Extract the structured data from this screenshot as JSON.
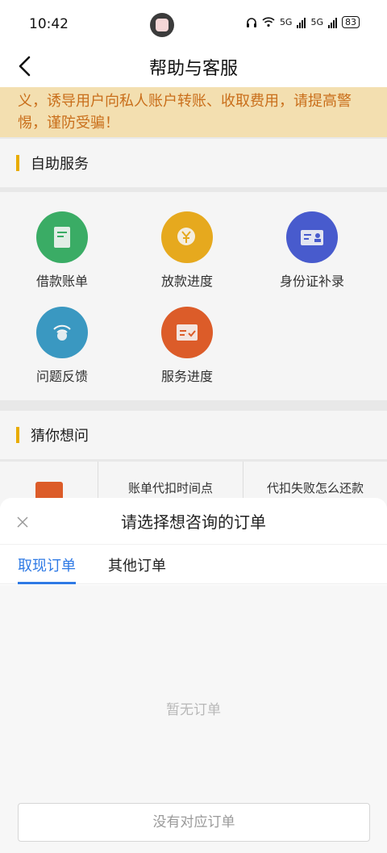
{
  "status": {
    "time": "10:42",
    "net1": "5G",
    "net2": "5G",
    "battery": "83"
  },
  "header": {
    "title": "帮助与客服"
  },
  "notice": {
    "text": "义，诱导用户向私人账户转账、收取费用，请提高警惕，谨防受骗！"
  },
  "self_service": {
    "title": "自助服务",
    "items": [
      {
        "label": "借款账单",
        "icon": "loan-bill-icon",
        "color": "#3db46a"
      },
      {
        "label": "放款进度",
        "icon": "yuan-progress-icon",
        "color": "#f0b020"
      },
      {
        "label": "身份证补录",
        "icon": "id-card-icon",
        "color": "#4b5fd6"
      },
      {
        "label": "问题反馈",
        "icon": "feedback-icon",
        "color": "#3d9fc9"
      },
      {
        "label": "服务进度",
        "icon": "service-progress-icon",
        "color": "#e5602b"
      }
    ]
  },
  "faq": {
    "title": "猜你想问",
    "items": [
      "账单代扣时间点",
      "代扣失败怎么还款"
    ]
  },
  "sheet": {
    "title": "请选择想咨询的订单",
    "tabs": [
      "取现订单",
      "其他订单"
    ],
    "empty_text": "暂无订单",
    "button_label": "没有对应订单",
    "accent": "#2f7ae5"
  }
}
